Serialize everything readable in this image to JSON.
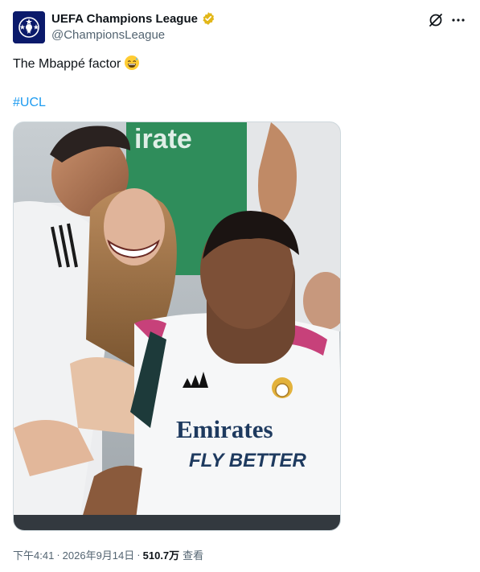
{
  "author": {
    "display_name": "UEFA Champions League",
    "handle": "@ChampionsLeague",
    "verified_color": "#e2b719"
  },
  "tweet": {
    "text": "The Mbappé factor",
    "emoji": "grinning-sweat-emoji",
    "hashtag": "#UCL"
  },
  "media": {
    "jersey_sponsor_line1": "Emirates",
    "jersey_sponsor_line2": "FLY BETTER",
    "background_shirt_text": "irate"
  },
  "meta": {
    "time": "下午4:41",
    "separator": "·",
    "date": "2026年9月14日",
    "views_count": "510.7万",
    "views_label": "查看"
  },
  "colors": {
    "link": "#1d9bf0",
    "secondary_text": "#536471",
    "primary_text": "#0f1419"
  }
}
